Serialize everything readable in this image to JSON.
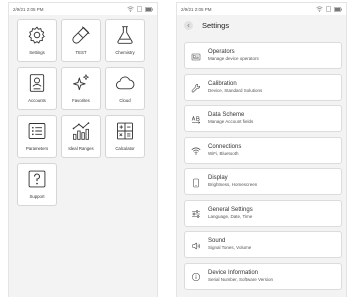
{
  "left": {
    "status": {
      "time": "2/9/21 2:05 PM"
    },
    "tiles": [
      {
        "label": "Settings",
        "icon": "gear-icon"
      },
      {
        "label": "TEST",
        "icon": "test-tube-icon"
      },
      {
        "label": "Chemistry",
        "icon": "flask-icon"
      },
      {
        "label": "Accounts",
        "icon": "account-card-icon"
      },
      {
        "label": "Favorites",
        "icon": "sparkle-icon"
      },
      {
        "label": "Cloud",
        "icon": "cloud-icon"
      },
      {
        "label": "Parameters",
        "icon": "list-icon"
      },
      {
        "label": "Ideal Ranges",
        "icon": "chart-icon"
      },
      {
        "label": "Calculator",
        "icon": "calculator-icon"
      },
      {
        "label": "Support",
        "icon": "question-icon"
      }
    ]
  },
  "right": {
    "status": {
      "time": "2/9/21 2:05 PM"
    },
    "header": {
      "title": "Settings",
      "back_icon": "chevron-left-icon"
    },
    "items": [
      {
        "title": "Operators",
        "subtitle": "Manage device operators",
        "icon": "operator-badge-icon"
      },
      {
        "title": "Calibration",
        "subtitle": "Device, Standard Solutions",
        "icon": "wrench-icon"
      },
      {
        "title": "Data Scheme",
        "subtitle": "Manage Account fields",
        "icon": "text-format-icon"
      },
      {
        "title": "Connections",
        "subtitle": "WiFi, Bluetooth",
        "icon": "wifi-icon"
      },
      {
        "title": "Display",
        "subtitle": "Brightness, Homescreen",
        "icon": "phone-icon"
      },
      {
        "title": "General Settings",
        "subtitle": "Language, Date, Time",
        "icon": "sliders-icon"
      },
      {
        "title": "Sound",
        "subtitle": "Signal Tones, Volume",
        "icon": "speaker-icon"
      },
      {
        "title": "Device Information",
        "subtitle": "Serial Number, Software Version",
        "icon": "info-icon"
      }
    ]
  }
}
